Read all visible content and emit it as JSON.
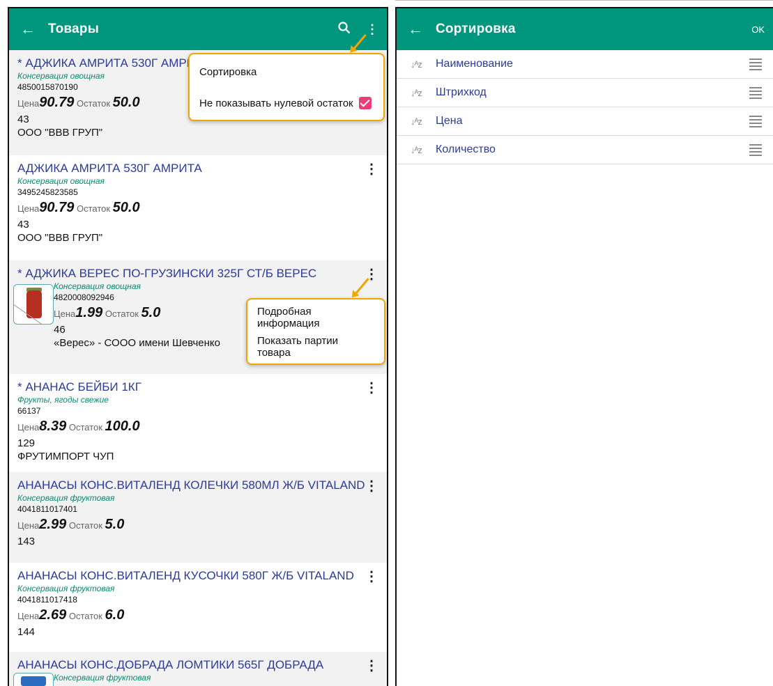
{
  "left": {
    "appbar": {
      "back_icon": "←",
      "title": "Товары",
      "search_icon": "⚲",
      "more_icon": "⋮"
    },
    "price_label": "Цена",
    "stock_label": "Остаток",
    "items": [
      {
        "name": "* АДЖИКА АМРИТА 530Г АМРИТА",
        "category": "Консервация овощная",
        "code": "4850015870190",
        "price": "90.79",
        "stock": "50.0",
        "num": "43",
        "vendor": "ООО \"ВВВ ГРУП\""
      },
      {
        "name": "АДЖИКА АМРИТА 530Г АМРИТА",
        "category": "Консервация овощная",
        "code": "3495245823585",
        "price": "90.79",
        "stock": "50.0",
        "num": "43",
        "vendor": "ООО \"ВВВ ГРУП\""
      },
      {
        "name": "* АДЖИКА ВЕРЕС ПО-ГРУЗИНСКИ 325Г СТ/Б ВЕРЕС",
        "category": "Консервация овощная",
        "code": "4820008092946",
        "price": "1.99",
        "stock": "5.0",
        "num": "46",
        "vendor": "«Верес» - СООО имени Шевченко"
      },
      {
        "name": "* АНАНАС БЕЙБИ 1КГ",
        "category": "Фрукты, ягоды свежие",
        "code": "66137",
        "price": "8.39",
        "stock": "100.0",
        "num": "129",
        "vendor": "ФРУТИМПОРТ ЧУП"
      },
      {
        "name": "АНАНАСЫ КОНС.ВИТАЛЕНД КОЛЕЧКИ 580МЛ Ж/Б VITALAND",
        "category": "Консервация фруктовая",
        "code": "4041811017401",
        "price": "2.99",
        "stock": "5.0",
        "num": "143"
      },
      {
        "name": "АНАНАСЫ КОНС.ВИТАЛЕНД КУСОЧКИ 580Г Ж/Б VITALAND",
        "category": "Консервация фруктовая",
        "code": "4041811017418",
        "price": "2.69",
        "stock": "6.0",
        "num": "144"
      },
      {
        "name": "АНАНАСЫ КОНС.ДОБРАДА ЛОМТИКИ 565Г ДОБРАДА",
        "category": "Консервация фруктовая"
      }
    ],
    "menu_popup": {
      "sort": "Сортировка",
      "hide_zero": "Не показывать нулевой остаток",
      "hide_zero_checked": true
    },
    "item_popup": {
      "details": "Подробная информация",
      "batches": "Показать партии товара"
    },
    "highlight_color": "#f0a500"
  },
  "right": {
    "appbar": {
      "back_icon": "←",
      "title": "Сортировка",
      "ok": "OK"
    },
    "sort_icon": "↓ᴬz",
    "rows": [
      "Наименование",
      "Штрихкод",
      "Цена",
      "Количество"
    ]
  },
  "colors": {
    "appbar": "#00967d",
    "link": "#2b3a9c",
    "category": "#0a8b73",
    "checkbox": "#ec3d78"
  }
}
